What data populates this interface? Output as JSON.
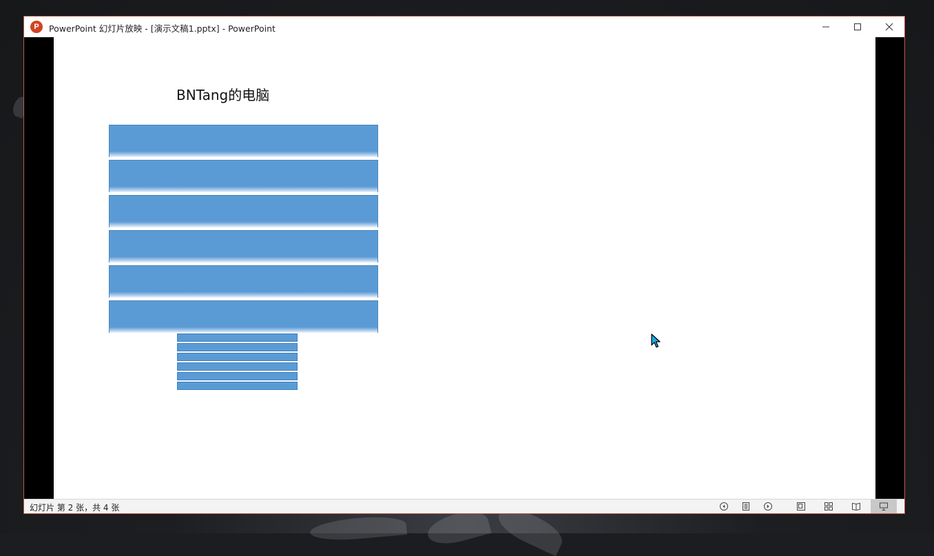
{
  "window": {
    "title": "PowerPoint 幻灯片放映 - [演示文稿1.pptx] - PowerPoint",
    "app_icon_letter": "P",
    "controls": {
      "minimize": "minimize-icon",
      "maximize": "maximize-icon",
      "close": "close-icon"
    },
    "border_color": "#c25a4a"
  },
  "slide": {
    "title": "BNTang的电脑",
    "shape_color": "#5b9bd5",
    "large_bars": 6,
    "small_bars": 6
  },
  "statusbar": {
    "slide_info": "幻灯片 第 2 张，共 4 张",
    "buttons": [
      "previous-icon",
      "menu-icon",
      "next-icon",
      "normal-view-icon",
      "slide-sorter-icon",
      "reading-view-icon",
      "slideshow-icon"
    ]
  }
}
